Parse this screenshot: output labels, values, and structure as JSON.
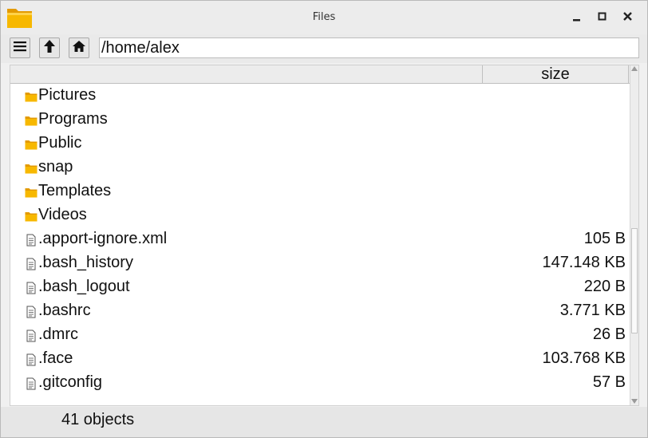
{
  "window": {
    "title": "Files",
    "colors": {
      "folder": "#f7b800",
      "folder_dark": "#e39a00",
      "background": "#f0f0f0"
    }
  },
  "titlebar": {
    "app_icon": "folder-app-icon",
    "controls": [
      "minimize-icon",
      "maximize-icon",
      "close-icon"
    ]
  },
  "toolbar": {
    "menu_icon": "hamburger-menu-icon",
    "up_icon": "arrow-up-icon",
    "home_icon": "home-icon",
    "path": "/home/alex"
  },
  "list": {
    "columns": {
      "name": "",
      "size": "size"
    },
    "rows": [
      {
        "type": "folder",
        "name": "Pictures",
        "size": ""
      },
      {
        "type": "folder",
        "name": "Programs",
        "size": ""
      },
      {
        "type": "folder",
        "name": "Public",
        "size": ""
      },
      {
        "type": "folder",
        "name": "snap",
        "size": ""
      },
      {
        "type": "folder",
        "name": "Templates",
        "size": ""
      },
      {
        "type": "folder",
        "name": "Videos",
        "size": ""
      },
      {
        "type": "file",
        "name": ".apport-ignore.xml",
        "size": "105 B"
      },
      {
        "type": "file",
        "name": ".bash_history",
        "size": "147.148 KB"
      },
      {
        "type": "file",
        "name": ".bash_logout",
        "size": "220 B"
      },
      {
        "type": "file",
        "name": ".bashrc",
        "size": "3.771 KB"
      },
      {
        "type": "file",
        "name": ".dmrc",
        "size": "26 B"
      },
      {
        "type": "file",
        "name": ".face",
        "size": "103.768 KB"
      },
      {
        "type": "file",
        "name": ".gitconfig",
        "size": "57 B"
      }
    ]
  },
  "status": {
    "text": "41 objects"
  }
}
